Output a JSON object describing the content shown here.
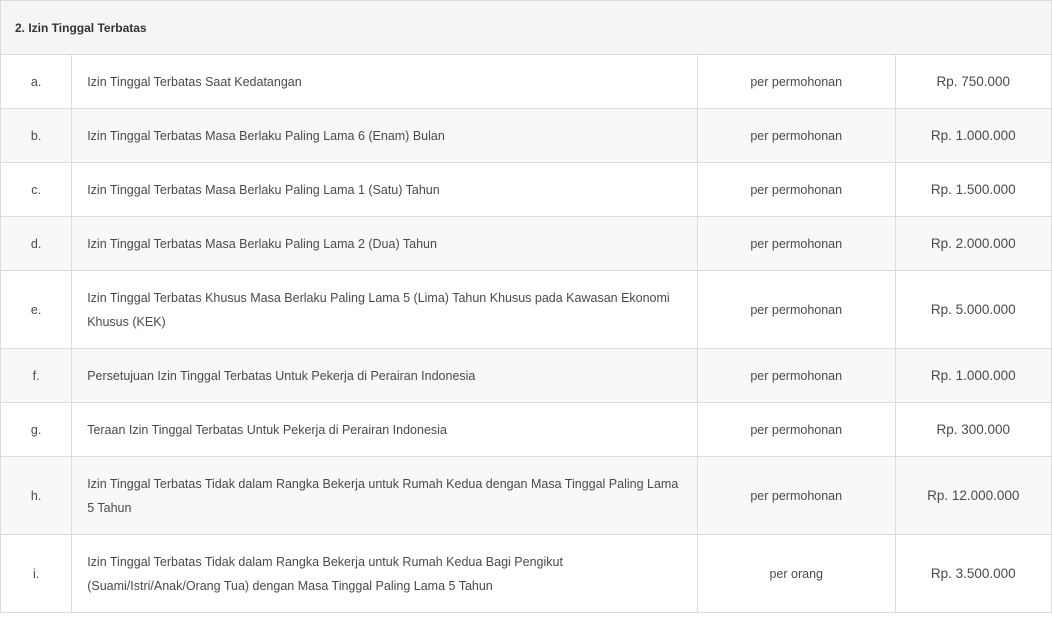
{
  "section": {
    "title": "2. Izin Tinggal Terbatas"
  },
  "rows": [
    {
      "letter": "a.",
      "description": "Izin Tinggal Terbatas Saat Kedatangan",
      "unit": "per permohonan",
      "price": "Rp. 750.000"
    },
    {
      "letter": "b.",
      "description": "Izin Tinggal Terbatas Masa Berlaku Paling Lama 6 (Enam) Bulan",
      "unit": "per permohonan",
      "price": "Rp. 1.000.000"
    },
    {
      "letter": "c.",
      "description": "Izin Tinggal Terbatas Masa Berlaku Paling Lama 1 (Satu) Tahun",
      "unit": "per permohonan",
      "price": "Rp. 1.500.000"
    },
    {
      "letter": "d.",
      "description": "Izin Tinggal Terbatas Masa Berlaku Paling Lama 2 (Dua) Tahun",
      "unit": "per permohonan",
      "price": "Rp. 2.000.000"
    },
    {
      "letter": "e.",
      "description": "Izin Tinggal Terbatas Khusus Masa Berlaku Paling Lama 5 (Lima) Tahun Khusus pada Kawasan Ekonomi Khusus (KEK)",
      "unit": "per permohonan",
      "price": "Rp. 5.000.000"
    },
    {
      "letter": "f.",
      "description": "Persetujuan Izin Tinggal Terbatas Untuk Pekerja di Perairan Indonesia",
      "unit": "per permohonan",
      "price": "Rp. 1.000.000"
    },
    {
      "letter": "g.",
      "description": "Teraan Izin Tinggal Terbatas Untuk Pekerja di Perairan Indonesia",
      "unit": "per permohonan",
      "price": "Rp. 300.000"
    },
    {
      "letter": "h.",
      "description": "Izin Tinggal Terbatas Tidak dalam Rangka Bekerja untuk Rumah Kedua dengan Masa Tinggal Paling Lama 5 Tahun",
      "unit": "per permohonan",
      "price": "Rp. 12.000.000"
    },
    {
      "letter": "i.",
      "description": "Izin Tinggal Terbatas Tidak dalam Rangka Bekerja untuk Rumah Kedua Bagi Pengikut (Suami/Istri/Anak/Orang Tua) dengan Masa Tinggal Paling Lama 5 Tahun",
      "unit": "per orang",
      "price": "Rp. 3.500.000"
    }
  ]
}
